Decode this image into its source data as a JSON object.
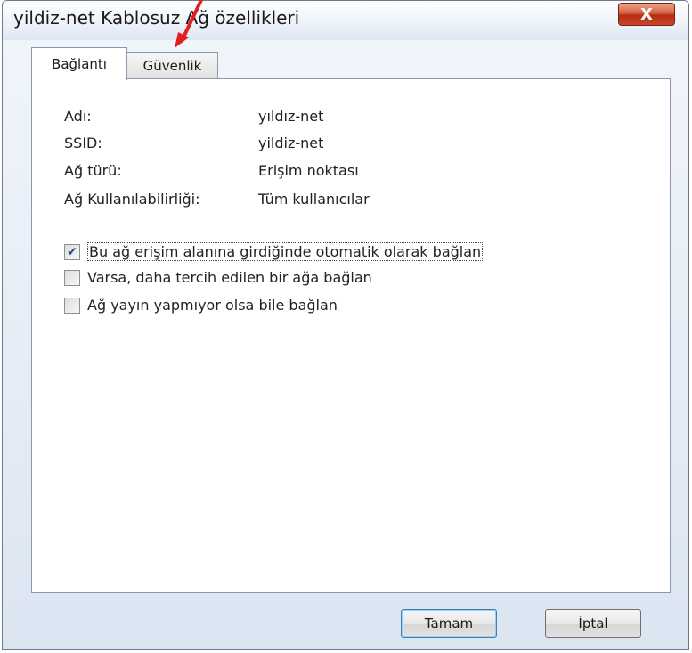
{
  "window": {
    "title": "yildiz-net Kablosuz Ağ özellikleri",
    "close_label": "X"
  },
  "tabs": [
    {
      "label": "Bağlantı",
      "active": true
    },
    {
      "label": "Güvenlik",
      "active": false
    }
  ],
  "info": {
    "name_label": "Adı:",
    "name_value": "yıldız-net",
    "ssid_label": "SSID:",
    "ssid_value": "yildiz-net",
    "type_label": "Ağ türü:",
    "type_value": "Erişim noktası",
    "availability_label": "Ağ Kullanılabilirliği:",
    "availability_value": "Tüm kullanıcılar"
  },
  "options": [
    {
      "label": "Bu ağ erişim alanına girdiğinde otomatik olarak bağlan",
      "checked": true
    },
    {
      "label": "Varsa, daha tercih edilen bir ağa bağlan",
      "checked": false
    },
    {
      "label": "Ağ yayın yapmıyor olsa bile bağlan",
      "checked": false
    }
  ],
  "buttons": {
    "ok_label": "Tamam",
    "cancel_label": "İptal"
  },
  "annotation": {
    "arrow_color": "#e02020"
  }
}
